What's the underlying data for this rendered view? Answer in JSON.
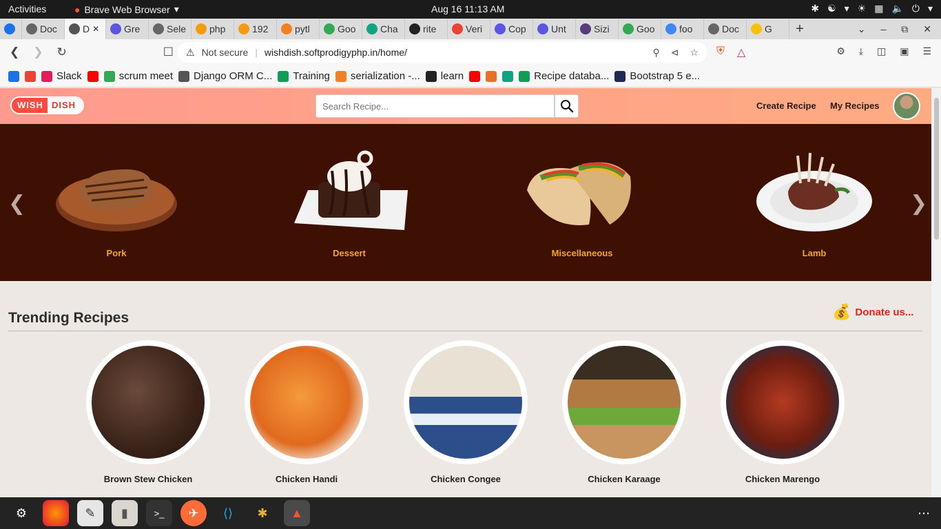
{
  "system": {
    "activities": "Activities",
    "app_name": "Brave Web Browser",
    "clock": "Aug 16  11:13 AM"
  },
  "tabs": [
    {
      "label": "Doc",
      "color": "#666"
    },
    {
      "label": "D",
      "color": "#555",
      "active": true
    },
    {
      "label": "Gre",
      "color": "#5b55e0"
    },
    {
      "label": "Sele",
      "color": "#666"
    },
    {
      "label": "php",
      "color": "#f39c12"
    },
    {
      "label": "192",
      "color": "#f39c12"
    },
    {
      "label": "pytl",
      "color": "#f48024"
    },
    {
      "label": "Goo",
      "color": "#34a853"
    },
    {
      "label": "Cha",
      "color": "#10a37f"
    },
    {
      "label": "rite",
      "color": "#222"
    },
    {
      "label": "Veri",
      "color": "#ea4335"
    },
    {
      "label": "Cop",
      "color": "#5b55e0"
    },
    {
      "label": "Unt",
      "color": "#5b55e0"
    },
    {
      "label": "Sizi",
      "color": "#563d7c"
    },
    {
      "label": "Goo",
      "color": "#34a853"
    },
    {
      "label": "foo",
      "color": "#4285f4"
    },
    {
      "label": "Doc",
      "color": "#666"
    },
    {
      "label": "G",
      "color": "#f4c20d"
    }
  ],
  "address": {
    "security": "Not secure",
    "url": "wishdish.softprodigyphp.in/home/"
  },
  "bookmarks": [
    {
      "label": "",
      "color": "#1a73e8"
    },
    {
      "label": "",
      "color": "#ea4335"
    },
    {
      "label": "Slack",
      "color": "#e01e5a"
    },
    {
      "label": "",
      "color": "#ff0000"
    },
    {
      "label": "scrum meet",
      "color": "#34a853"
    },
    {
      "label": "Django ORM C...",
      "color": "#555"
    },
    {
      "label": "Training",
      "color": "#0f9d58"
    },
    {
      "label": "serialization -...",
      "color": "#f48024"
    },
    {
      "label": "learn",
      "color": "#222"
    },
    {
      "label": "",
      "color": "#ff0000"
    },
    {
      "label": "",
      "color": "#e8712a"
    },
    {
      "label": "",
      "color": "#10a37f"
    },
    {
      "label": "Recipe databa...",
      "color": "#0f9d58"
    },
    {
      "label": "Bootstrap 5 e...",
      "color": "#1e2a55"
    }
  ],
  "site": {
    "logo_left": "WISH",
    "logo_right": "DISH",
    "search_placeholder": "Search Recipe...",
    "nav_create": "Create Recipe",
    "nav_my": "My Recipes"
  },
  "categories": [
    {
      "label": "Pork",
      "icon": "pork-steak"
    },
    {
      "label": "Dessert",
      "icon": "chocolate-dessert"
    },
    {
      "label": "Miscellaneous",
      "icon": "tacos"
    },
    {
      "label": "Lamb",
      "icon": "lamb-rack"
    }
  ],
  "trending": {
    "title": "Trending Recipes",
    "donate": "Donate us...",
    "recipes": [
      {
        "name": "Brown Stew Chicken",
        "tone": "#4a3026"
      },
      {
        "name": "Chicken Handi",
        "tone": "#e27a2a"
      },
      {
        "name": "Chicken Congee",
        "tone": "#d8cfbf"
      },
      {
        "name": "Chicken Karaage",
        "tone": "#8a6a44"
      },
      {
        "name": "Chicken Marengo",
        "tone": "#7a2b1a"
      }
    ]
  },
  "colors": {
    "brand": "#ff4b3e",
    "hero_bg": "#3e0f03",
    "category_label": "#f2a81d",
    "donate": "#e0271b"
  }
}
